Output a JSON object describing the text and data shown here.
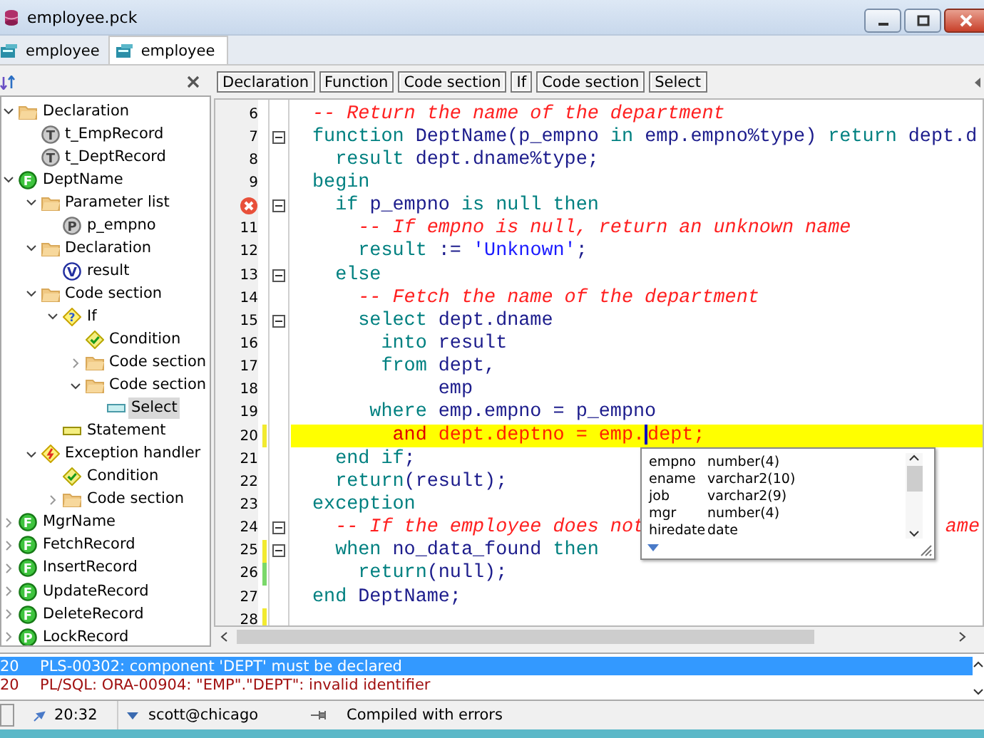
{
  "window": {
    "title": "employee.pck"
  },
  "tabs": [
    {
      "label": "employee",
      "selected": false
    },
    {
      "label": "employee",
      "selected": true
    }
  ],
  "tree": [
    {
      "label": "Declaration",
      "kind": "folder",
      "expanded": true,
      "children": [
        {
          "label": "t_EmpRecord",
          "kind": "type",
          "badge": "T"
        },
        {
          "label": "t_DeptRecord",
          "kind": "type",
          "badge": "T"
        }
      ]
    },
    {
      "label": "DeptName",
      "kind": "function",
      "badge": "F",
      "expanded": true,
      "children": [
        {
          "label": "Parameter list",
          "kind": "folder",
          "expanded": true,
          "children": [
            {
              "label": "p_empno",
              "kind": "param",
              "badge": "P"
            }
          ]
        },
        {
          "label": "Declaration",
          "kind": "folder",
          "expanded": true,
          "children": [
            {
              "label": "result",
              "kind": "variable",
              "badge": "V"
            }
          ]
        },
        {
          "label": "Code section",
          "kind": "folder",
          "expanded": true,
          "children": [
            {
              "label": "If",
              "kind": "if",
              "badge": "?",
              "expanded": true,
              "children": [
                {
                  "label": "Condition",
                  "kind": "condition"
                },
                {
                  "label": "Code section",
                  "kind": "folder",
                  "expanded": false
                },
                {
                  "label": "Code section",
                  "kind": "folder",
                  "expanded": true,
                  "children": [
                    {
                      "label": "Select",
                      "kind": "select",
                      "selected": true
                    }
                  ]
                }
              ]
            },
            {
              "label": "Statement",
              "kind": "statement"
            }
          ]
        },
        {
          "label": "Exception handler",
          "kind": "exception",
          "expanded": true,
          "children": [
            {
              "label": "Condition",
              "kind": "condition"
            },
            {
              "label": "Code section",
              "kind": "folder",
              "expanded": false
            }
          ]
        }
      ]
    },
    {
      "label": "MgrName",
      "kind": "function",
      "badge": "F",
      "expanded": false
    },
    {
      "label": "FetchRecord",
      "kind": "function",
      "badge": "F",
      "expanded": false
    },
    {
      "label": "InsertRecord",
      "kind": "function",
      "badge": "F",
      "expanded": false
    },
    {
      "label": "UpdateRecord",
      "kind": "function",
      "badge": "F",
      "expanded": false
    },
    {
      "label": "DeleteRecord",
      "kind": "function",
      "badge": "F",
      "expanded": false
    },
    {
      "label": "LockRecord",
      "kind": "procedure",
      "badge": "P",
      "expanded": false
    }
  ],
  "breadcrumbs": [
    "Declaration",
    "Function",
    "Code section",
    "If",
    "Code section",
    "Select"
  ],
  "code": [
    {
      "number": "6",
      "tokens": [
        {
          "kind": "comment",
          "text": "-- Return the name of the department"
        }
      ]
    },
    {
      "number": "7",
      "fold": true,
      "tokens": [
        {
          "kind": "keyword",
          "text": "function"
        },
        {
          "kind": "ident",
          "text": " DeptName(p_empno "
        },
        {
          "kind": "keyword",
          "text": "in"
        },
        {
          "kind": "ident",
          "text": " emp.empno%type) "
        },
        {
          "kind": "keyword",
          "text": "return"
        },
        {
          "kind": "ident",
          "text": " dept.d"
        }
      ]
    },
    {
      "number": "8",
      "tokens": [
        {
          "kind": "keyword",
          "text": "  result"
        },
        {
          "kind": "ident",
          "text": " dept.dname%type;"
        }
      ]
    },
    {
      "number": "9",
      "tokens": [
        {
          "kind": "keyword",
          "text": "begin"
        }
      ]
    },
    {
      "error": true,
      "fold": true,
      "tokens": [
        {
          "kind": "keyword",
          "text": "  if"
        },
        {
          "kind": "ident",
          "text": " p_empno "
        },
        {
          "kind": "keyword",
          "text": "is null then"
        }
      ]
    },
    {
      "number": "11",
      "tokens": [
        {
          "kind": "comment",
          "text": "    -- If empno is null, return an unknown name"
        }
      ]
    },
    {
      "number": "12",
      "tokens": [
        {
          "kind": "keyword",
          "text": "    result"
        },
        {
          "kind": "ident",
          "text": " := "
        },
        {
          "kind": "string",
          "text": "'Unknown'"
        },
        {
          "kind": "ident",
          "text": ";"
        }
      ]
    },
    {
      "number": "13",
      "fold": true,
      "tokens": [
        {
          "kind": "keyword",
          "text": "  else"
        }
      ]
    },
    {
      "number": "14",
      "tokens": [
        {
          "kind": "comment",
          "text": "    -- Fetch the name of the department"
        }
      ]
    },
    {
      "number": "15",
      "fold": true,
      "tokens": [
        {
          "kind": "keyword",
          "text": "    select"
        },
        {
          "kind": "ident",
          "text": " dept.dname"
        }
      ]
    },
    {
      "number": "16",
      "tokens": [
        {
          "kind": "keyword",
          "text": "      into"
        },
        {
          "kind": "ident",
          "text": " result"
        }
      ]
    },
    {
      "number": "17",
      "tokens": [
        {
          "kind": "keyword",
          "text": "      from"
        },
        {
          "kind": "ident",
          "text": " dept,"
        }
      ]
    },
    {
      "number": "18",
      "tokens": [
        {
          "kind": "ident",
          "text": "           emp"
        }
      ]
    },
    {
      "number": "19",
      "tokens": [
        {
          "kind": "keyword",
          "text": "     where"
        },
        {
          "kind": "ident",
          "text": " emp.empno = p_empno"
        }
      ]
    },
    {
      "number": "20",
      "color": "#f2ea30",
      "highlighted": true,
      "tokens": [
        {
          "kind": "keyword",
          "text": "       and"
        },
        {
          "kind": "ident",
          "text": " dept.deptno = emp."
        },
        {
          "kind": "caret"
        },
        {
          "kind": "ident",
          "text": "dept;"
        }
      ]
    },
    {
      "number": "21",
      "tokens": [
        {
          "kind": "keyword",
          "text": "  end if"
        },
        {
          "kind": "ident",
          "text": ";"
        }
      ]
    },
    {
      "number": "22",
      "tokens": [
        {
          "kind": "keyword",
          "text": "  return"
        },
        {
          "kind": "ident",
          "text": "(result);"
        }
      ]
    },
    {
      "number": "23",
      "tokens": [
        {
          "kind": "keyword",
          "text": "exception"
        }
      ]
    },
    {
      "number": "24",
      "fold": true,
      "tokens": [
        {
          "kind": "comment",
          "text": "  -- If the employee does not"
        },
        {
          "kind": "comment-tail",
          "text": "ame"
        }
      ]
    },
    {
      "number": "25",
      "fold": true,
      "color": "#f2ea30",
      "tokens": [
        {
          "kind": "keyword",
          "text": "  when"
        },
        {
          "kind": "ident",
          "text": " no_data_found "
        },
        {
          "kind": "keyword",
          "text": "then"
        }
      ]
    },
    {
      "number": "26",
      "color": "#7ad86a",
      "tokens": [
        {
          "kind": "keyword",
          "text": "    return"
        },
        {
          "kind": "ident",
          "text": "(null);"
        }
      ]
    },
    {
      "number": "27",
      "tokens": [
        {
          "kind": "keyword",
          "text": "end"
        },
        {
          "kind": "ident",
          "text": " DeptName;"
        }
      ]
    },
    {
      "number": "28",
      "color": "#f2ea30"
    }
  ],
  "completion": [
    {
      "name": "empno",
      "type": "number(4)"
    },
    {
      "name": "ename",
      "type": "varchar2(10)"
    },
    {
      "name": "job",
      "type": "varchar2(9)"
    },
    {
      "name": "mgr",
      "type": "number(4)"
    },
    {
      "name": "hiredate",
      "type": "date"
    }
  ],
  "messages": [
    {
      "line": "20",
      "text": "PLS-00302: component 'DEPT' must be declared",
      "selected": true
    },
    {
      "line": "20",
      "text": "PL/SQL: ORA-00904: \"EMP\".\"DEPT\": invalid identifier",
      "selected": false
    }
  ],
  "status_bar": {
    "position": "20:32",
    "connection": "scott@chicago",
    "state": "Compiled with errors"
  }
}
